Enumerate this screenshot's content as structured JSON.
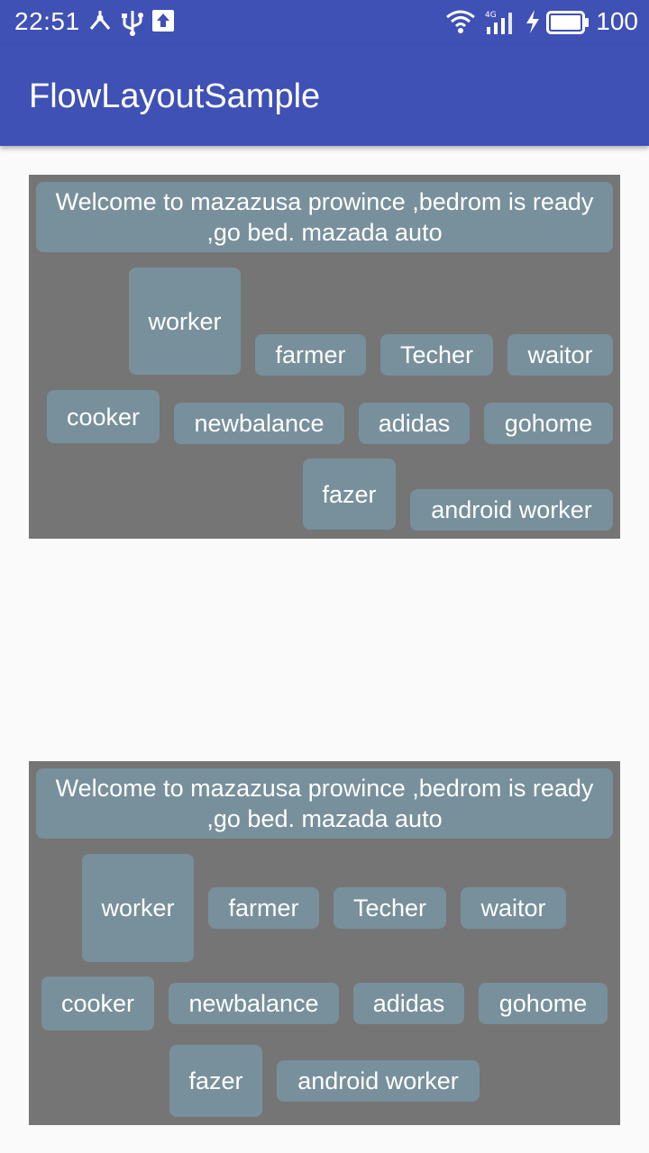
{
  "status_bar": {
    "time": "22:51",
    "battery": "100",
    "icons": [
      "share-icon",
      "usb-icon",
      "upload-icon",
      "wifi-icon",
      "signal-4g-icon",
      "charging-icon",
      "battery-icon"
    ]
  },
  "app_bar": {
    "title": "FlowLayoutSample"
  },
  "colors": {
    "primary": "#3f51b5",
    "panel_bg": "#757575",
    "tag_bg": "#78909c",
    "page_bg": "#fafafa"
  },
  "flow_top": {
    "tags": [
      "Welcome to mazazusa prowince ,bedrom is ready ,go bed. mazada auto",
      "worker",
      "farmer",
      "Techer",
      "waitor",
      "cooker",
      "newbalance",
      "adidas",
      "gohome",
      "fazer",
      "android worker"
    ]
  },
  "flow_bottom": {
    "tags": [
      "Welcome to mazazusa prowince ,bedrom is ready ,go bed. mazada auto",
      "worker",
      "farmer",
      "Techer",
      "waitor",
      "cooker",
      "newbalance",
      "adidas",
      "gohome",
      "fazer",
      "android worker"
    ]
  }
}
